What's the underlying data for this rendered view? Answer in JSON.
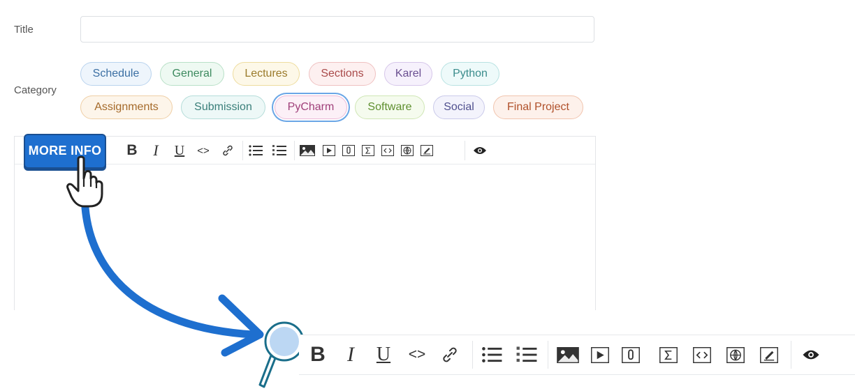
{
  "form": {
    "title_label": "Title",
    "title_value": "",
    "title_placeholder": "",
    "category_label": "Category"
  },
  "categories": [
    {
      "label": "Schedule",
      "color": "#3b6fa3",
      "border": "#b9d3ee",
      "bg": "#eef5fc"
    },
    {
      "label": "General",
      "color": "#3d8a5f",
      "border": "#b8e0c7",
      "bg": "#eef9f2"
    },
    {
      "label": "Lectures",
      "color": "#9a7a2a",
      "border": "#eedc9e",
      "bg": "#fdf8e8"
    },
    {
      "label": "Sections",
      "color": "#a94a4a",
      "border": "#efc1c1",
      "bg": "#fdf0f0"
    },
    {
      "label": "Karel",
      "color": "#6a4f91",
      "border": "#d6c6ea",
      "bg": "#f6f1fc"
    },
    {
      "label": "Python",
      "color": "#3a8c8c",
      "border": "#b8e2e2",
      "bg": "#eefafa"
    },
    {
      "label": "Assignments",
      "color": "#a56a2a",
      "border": "#efcfa6",
      "bg": "#fdf5ea"
    },
    {
      "label": "Submission",
      "color": "#3a7f7a",
      "border": "#b5ddd9",
      "bg": "#edf8f7"
    },
    {
      "label": "PyCharm",
      "color": "#a0407a",
      "border": "#ecbad8",
      "bg": "#fcf0f7",
      "selected": true
    },
    {
      "label": "Software",
      "color": "#5f8f2f",
      "border": "#cfe6b5",
      "bg": "#f5fbee"
    },
    {
      "label": "Social",
      "color": "#50508f",
      "border": "#cacaea",
      "bg": "#f3f3fc"
    },
    {
      "label": "Final Project",
      "color": "#b0502a",
      "border": "#f1c4ae",
      "bg": "#fdf1eb"
    }
  ],
  "callout": {
    "button_label": "MORE INFO",
    "accent": "#1e6fcf"
  },
  "toolbar": {
    "bold_label": "B",
    "italic_label": "I",
    "underline_label": "U",
    "code_label": "<>",
    "icons": [
      "bold-icon",
      "italic-icon",
      "underline-icon",
      "code-icon",
      "link-icon",
      "bullet-list-icon",
      "numbered-list-icon",
      "image-icon",
      "video-icon",
      "attachment-icon",
      "math-icon",
      "code-block-icon",
      "web-embed-icon",
      "draw-icon",
      "preview-eye-icon"
    ]
  }
}
